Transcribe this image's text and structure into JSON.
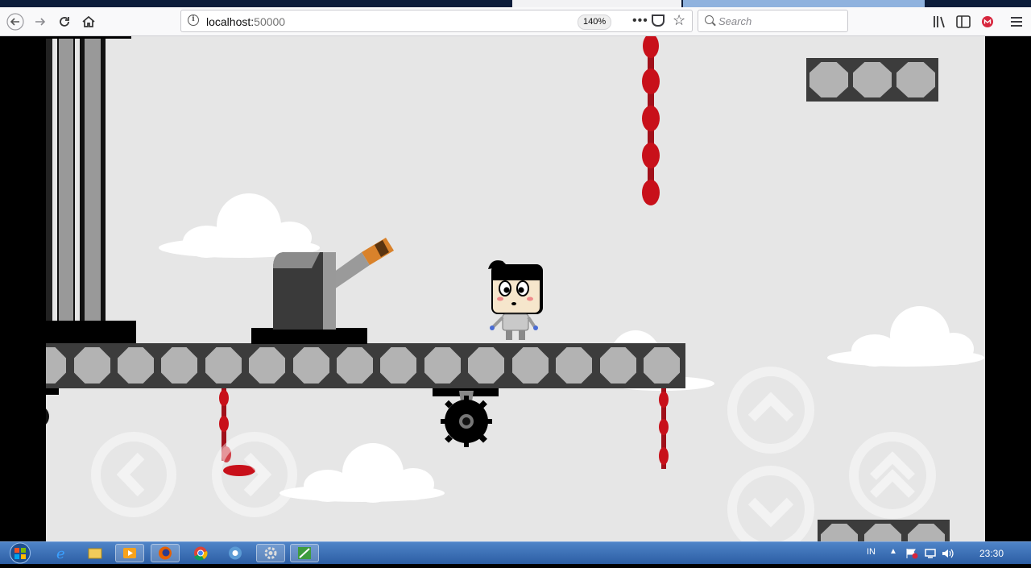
{
  "browser": {
    "url_host": "localhost:",
    "url_port": "50000",
    "zoom": "140%",
    "search_placeholder": "Search",
    "page_actions_glyph": "•••"
  },
  "game": {
    "controls": [
      "left-arrow-control",
      "right-arrow-control",
      "jump-control",
      "down-control",
      "double-jump-control"
    ]
  },
  "taskbar": {
    "keyboard_layout": "IN",
    "clock": "23:30",
    "icons": [
      "start-orb",
      "ie-icon",
      "explorer-icon",
      "media-player-icon",
      "firefox-icon",
      "chrome-icon",
      "chrome-alt-icon",
      "settings-icon",
      "app-icon"
    ]
  },
  "colors": {
    "sky": "#e6e6e6",
    "platform_frame": "#3c3c3c",
    "platform_block": "#b3b3b3",
    "blood": "#c8101a",
    "taskbar": "#2c5ea4"
  }
}
